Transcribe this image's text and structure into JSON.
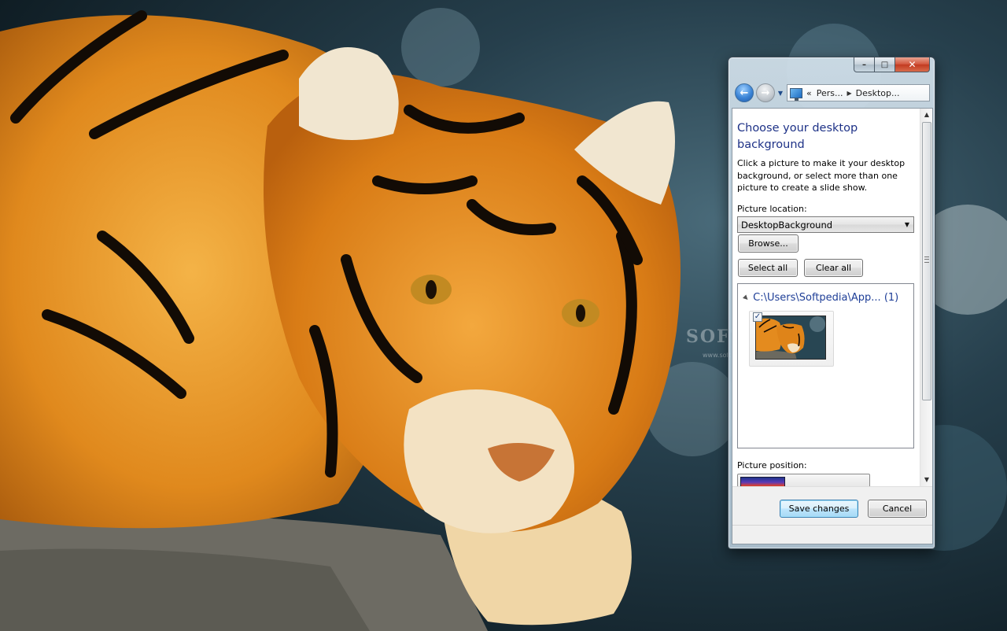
{
  "window": {
    "caption_minimize": "–",
    "caption_maximize": "□",
    "caption_close": "✕"
  },
  "address_bar": {
    "overflow_glyph": "«",
    "crumbs": [
      "Pers...",
      "Desktop..."
    ],
    "separator": "▶"
  },
  "content": {
    "title": "Choose your desktop background",
    "description": "Click a picture to make it your desktop background, or select more than one picture to create a slide show.",
    "picture_location_label": "Picture location:",
    "picture_location_value": "DesktopBackground",
    "browse_label": "Browse...",
    "select_all_label": "Select all",
    "clear_all_label": "Clear all",
    "group_header": "C:\\Users\\Softpedia\\App...  (1)",
    "thumbnail_checked": "✓",
    "picture_position_label": "Picture position:"
  },
  "footer": {
    "save_label": "Save changes",
    "cancel_label": "Cancel"
  },
  "watermark": {
    "text": "SOFTPEDIA",
    "url": "www.softpedia.com"
  },
  "colors": {
    "title_blue": "#1e3287",
    "link_blue": "#1e3e97",
    "accent_button": "#3c7fb1"
  }
}
